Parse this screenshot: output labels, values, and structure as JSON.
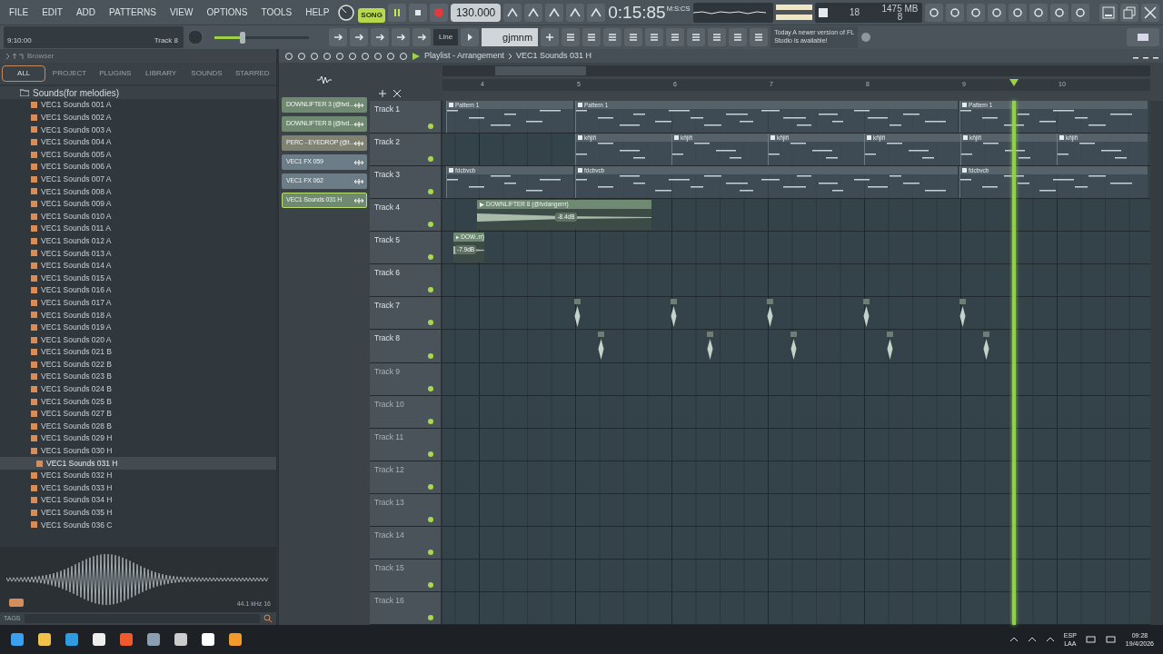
{
  "menu": [
    "FILE",
    "EDIT",
    "ADD",
    "PATTERNS",
    "VIEW",
    "OPTIONS",
    "TOOLS",
    "HELP"
  ],
  "transport": {
    "mode": "SONG",
    "tempo": "130.000",
    "time": "0:15:85",
    "time_unit": "M:S:CS"
  },
  "cpu": {
    "polyphony": "18",
    "memory": "1475 MB",
    "count": "8"
  },
  "hint": {
    "time": "9:10:00",
    "target": "Track 8"
  },
  "master_volume": {
    "level": 0.3
  },
  "snap": "Line",
  "pattern": "gjmnm",
  "news": {
    "when": "Today",
    "text": "A newer version of FL Studio is available!"
  },
  "browser": {
    "title": "Browser",
    "tabs": [
      {
        "label": "ALL",
        "selected": true
      },
      {
        "label": "PROJECT",
        "selected": false
      },
      {
        "label": "PLUGINS",
        "selected": false
      },
      {
        "label": "LIBRARY",
        "selected": false
      },
      {
        "label": "SOUNDS",
        "selected": false
      },
      {
        "label": "STARRED",
        "selected": false
      }
    ],
    "folder": "Sounds(for melodies)",
    "items": [
      {
        "label": "VEC1 Sounds 001 A",
        "selected": false
      },
      {
        "label": "VEC1 Sounds 002 A",
        "selected": false
      },
      {
        "label": "VEC1 Sounds 003 A",
        "selected": false
      },
      {
        "label": "VEC1 Sounds 004 A",
        "selected": false
      },
      {
        "label": "VEC1 Sounds 005 A",
        "selected": false
      },
      {
        "label": "VEC1 Sounds 006 A",
        "selected": false
      },
      {
        "label": "VEC1 Sounds 007 A",
        "selected": false
      },
      {
        "label": "VEC1 Sounds 008 A",
        "selected": false
      },
      {
        "label": "VEC1 Sounds 009 A",
        "selected": false
      },
      {
        "label": "VEC1 Sounds 010 A",
        "selected": false
      },
      {
        "label": "VEC1 Sounds 011 A",
        "selected": false
      },
      {
        "label": "VEC1 Sounds 012 A",
        "selected": false
      },
      {
        "label": "VEC1 Sounds 013 A",
        "selected": false
      },
      {
        "label": "VEC1 Sounds 014 A",
        "selected": false
      },
      {
        "label": "VEC1 Sounds 015 A",
        "selected": false
      },
      {
        "label": "VEC1 Sounds 016 A",
        "selected": false
      },
      {
        "label": "VEC1 Sounds 017 A",
        "selected": false
      },
      {
        "label": "VEC1 Sounds 018 A",
        "selected": false
      },
      {
        "label": "VEC1 Sounds 019 A",
        "selected": false
      },
      {
        "label": "VEC1 Sounds 020 A",
        "selected": false
      },
      {
        "label": "VEC1 Sounds 021 B",
        "selected": false
      },
      {
        "label": "VEC1 Sounds 022 B",
        "selected": false
      },
      {
        "label": "VEC1 Sounds 023 B",
        "selected": false
      },
      {
        "label": "VEC1 Sounds 024 B",
        "selected": false
      },
      {
        "label": "VEC1 Sounds 025 B",
        "selected": false
      },
      {
        "label": "VEC1 Sounds 027 B",
        "selected": false
      },
      {
        "label": "VEC1 Sounds 028 B",
        "selected": false
      },
      {
        "label": "VEC1 Sounds 029 H",
        "selected": false
      },
      {
        "label": "VEC1 Sounds 030 H",
        "selected": false
      },
      {
        "label": "VEC1 Sounds 031 H",
        "selected": true
      },
      {
        "label": "VEC1 Sounds 032 H",
        "selected": false
      },
      {
        "label": "VEC1 Sounds 033 H",
        "selected": false
      },
      {
        "label": "VEC1 Sounds 034 H",
        "selected": false
      },
      {
        "label": "VEC1 Sounds 035 H",
        "selected": false
      },
      {
        "label": "VEC1 Sounds 036 C",
        "selected": false
      }
    ],
    "sample_info": "44.1 kHz 16",
    "tags_label": "TAGS"
  },
  "picker": [
    {
      "label": "DOWNLIFTER 3 (@tvd...",
      "color": "#6f8a70",
      "selected": false
    },
    {
      "label": "DOWNLIFTER 8 (@tvd...",
      "color": "#6f8a70",
      "selected": false
    },
    {
      "label": "PERC - EYEDROP (@t...",
      "color": "#7f8270",
      "selected": false
    },
    {
      "label": "VEC1 FX 059",
      "color": "#6c7d88",
      "selected": false
    },
    {
      "label": "VEC1 FX 062",
      "color": "#6c7d88",
      "selected": false
    },
    {
      "label": "VEC1 Sounds 031 H",
      "color": "#6f8a70",
      "selected": true
    }
  ],
  "playlist": {
    "title": "Playlist - Arrangement",
    "pattern": "VEC1 Sounds 031 H",
    "ruler": [
      "4",
      "5",
      "6",
      "7",
      "8",
      "9",
      "10"
    ],
    "tracks": [
      {
        "name": "Track 1",
        "empty": false,
        "clips": [
          {
            "kind": "pattern",
            "label": "Pattern 1"
          },
          {
            "kind": "pattern",
            "label": "Pattern 1"
          },
          {
            "kind": "pattern",
            "label": "Pattern 1"
          }
        ]
      },
      {
        "name": "Track 2",
        "empty": false,
        "clips": [
          {
            "kind": "pattern",
            "label": "kñjlñ"
          },
          {
            "kind": "pattern",
            "label": "kñjlñ"
          },
          {
            "kind": "pattern",
            "label": "kñjlñ"
          },
          {
            "kind": "pattern",
            "label": "kñjlñ"
          },
          {
            "kind": "pattern",
            "label": "kñjlñ"
          },
          {
            "kind": "pattern",
            "label": "kñjlñ"
          }
        ]
      },
      {
        "name": "Track 3",
        "empty": false,
        "clips": [
          {
            "kind": "pattern",
            "label": "fdcbvcb"
          },
          {
            "kind": "pattern",
            "label": "fdcbvcb"
          },
          {
            "kind": "pattern",
            "label": "fdcbvcb"
          }
        ]
      },
      {
        "name": "Track 4",
        "empty": false,
        "clips": [
          {
            "kind": "audio",
            "label": "DOWNLIFTER 8 (@tvdangerrr)",
            "volume": "-8.4dB"
          }
        ]
      },
      {
        "name": "Track 5",
        "empty": false,
        "clips": [
          {
            "kind": "audio",
            "label": "DOW..rr)",
            "volume": "-7.9dB"
          }
        ]
      },
      {
        "name": "Track 6",
        "empty": false
      },
      {
        "name": "Track 7",
        "empty": false,
        "clips": [
          {
            "kind": "sample"
          },
          {
            "kind": "sample"
          },
          {
            "kind": "sample"
          },
          {
            "kind": "sample"
          },
          {
            "kind": "sample"
          }
        ]
      },
      {
        "name": "Track 8",
        "empty": false,
        "clips": [
          {
            "kind": "sample"
          },
          {
            "kind": "sample"
          },
          {
            "kind": "sample"
          },
          {
            "kind": "sample"
          },
          {
            "kind": "sample"
          }
        ]
      },
      {
        "name": "Track 9",
        "empty": true
      },
      {
        "name": "Track 10",
        "empty": true
      },
      {
        "name": "Track 11",
        "empty": true
      },
      {
        "name": "Track 12",
        "empty": true
      },
      {
        "name": "Track 13",
        "empty": true
      },
      {
        "name": "Track 14",
        "empty": true
      },
      {
        "name": "Track 15",
        "empty": true
      },
      {
        "name": "Track 16",
        "empty": true
      }
    ]
  },
  "taskbar": {
    "lang": "ESP",
    "layout": "LAA",
    "time": "09:28",
    "date": "19/4/2026"
  }
}
